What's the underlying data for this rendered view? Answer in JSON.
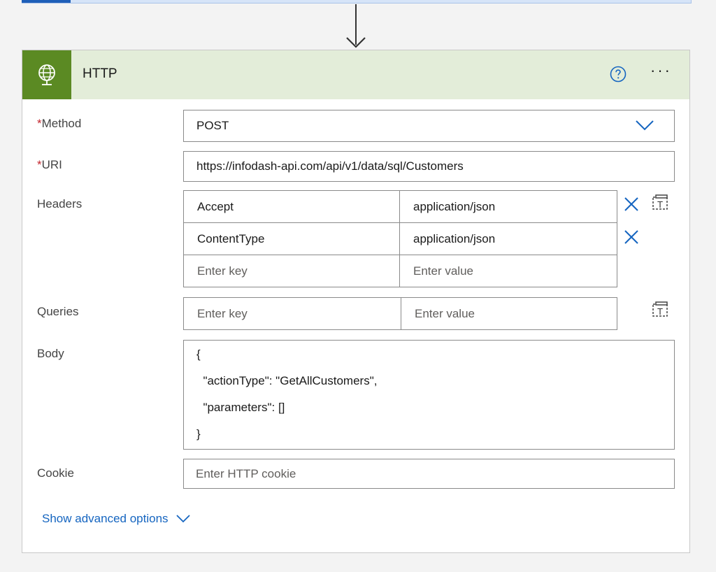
{
  "colors": {
    "accent_blue": "#1565c0",
    "http_green": "#5b8a23",
    "header_bg": "#e3edd9",
    "required_red": "#c4262e"
  },
  "icons": {
    "action": "globe-icon",
    "help": "help-circle-icon",
    "more": "more-options-icon",
    "dropdown": "chevron-down-icon",
    "remove": "close-icon",
    "table_mode": "switch-to-text-mode-icon"
  },
  "action": {
    "title": "HTTP",
    "more_label": "···"
  },
  "method": {
    "required_mark": "*",
    "label": "Method",
    "value": "POST"
  },
  "uri": {
    "required_mark": "*",
    "label": "URI",
    "value": "https://infodash-api.com/api/v1/data/sql/Customers"
  },
  "headers": {
    "label": "Headers",
    "rows": [
      {
        "key": "Accept",
        "value": "application/json"
      },
      {
        "key": "ContentType",
        "value": "application/json"
      }
    ],
    "key_placeholder": "Enter key",
    "value_placeholder": "Enter value"
  },
  "queries": {
    "label": "Queries",
    "key_placeholder": "Enter key",
    "value_placeholder": "Enter value"
  },
  "body": {
    "label": "Body",
    "lines": [
      "{",
      "  \"actionType\": \"GetAllCustomers\",",
      "  \"parameters\": []",
      "}"
    ]
  },
  "cookie": {
    "label": "Cookie",
    "placeholder": "Enter HTTP cookie"
  },
  "advanced": {
    "label": "Show advanced options"
  }
}
